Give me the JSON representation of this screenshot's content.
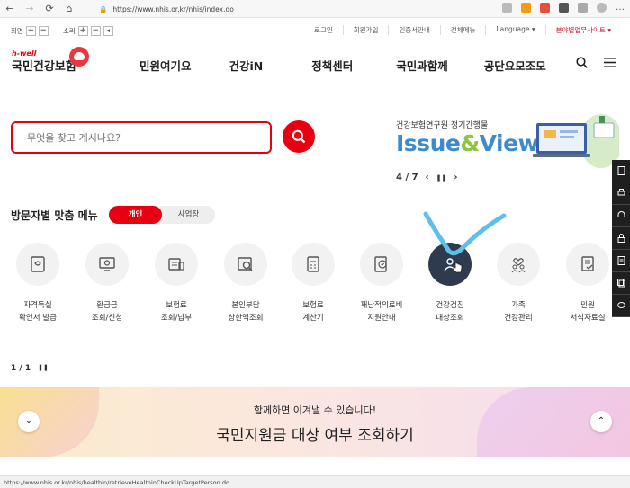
{
  "browser": {
    "url": "https://www.nhis.or.kr/nhis/index.do",
    "status_url": "https://www.nhis.or.kr/nhis/healthin/retrieveHealthinCheckUpTargetPerson.do"
  },
  "utility": {
    "screen_label": "화면",
    "sound_label": "소리",
    "plus": "+",
    "minus": "−",
    "links": [
      "로그인",
      "회원가입",
      "인증서안내",
      "전체메뉴",
      "Language ▾",
      "분야별업무사이트 ▾"
    ]
  },
  "header": {
    "logo_en": "h-well",
    "logo_ko": "국민건강보험",
    "nav": [
      "민원여기요",
      "건강iN",
      "정책센터",
      "국민과함께",
      "공단요모조모"
    ]
  },
  "search": {
    "placeholder": "무엇을 찾고 계시나요?"
  },
  "promo": {
    "subtitle": "건강보험연구원 정기간행물",
    "title_a": "Issue",
    "title_amp": "&",
    "title_b": "View",
    "pager": "4 / 7",
    "prev": "‹",
    "pause": "❚❚",
    "next": "›"
  },
  "menu": {
    "title": "방문자별 맞춤 메뉴",
    "toggle": [
      "개인",
      "사업장"
    ],
    "items": [
      {
        "label": "자격득실\n확인서 발급"
      },
      {
        "label": "환급금\n조회/신청"
      },
      {
        "label": "보험료\n조회/납부"
      },
      {
        "label": "본인부담\n상한액조회"
      },
      {
        "label": "보험료\n계산기"
      },
      {
        "label": "재난적의료비\n지원안내"
      },
      {
        "label": "건강검진\n대상조회"
      },
      {
        "label": "가족\n건강관리"
      },
      {
        "label": "민원\n서식자료실"
      }
    ],
    "counter": "1 / 1",
    "pause": "❚❚"
  },
  "banner": {
    "sub": "함께하면 이겨낼 수 있습니다!",
    "main": "국민지원금 대상 여부 조회하기",
    "down": "⌄",
    "up": "⌃"
  },
  "colors": {
    "brand_red": "#e60012",
    "active_icon_bg": "#2e3a4e",
    "issue_blue": "#3c8bd0",
    "view_green": "#8cc540"
  }
}
